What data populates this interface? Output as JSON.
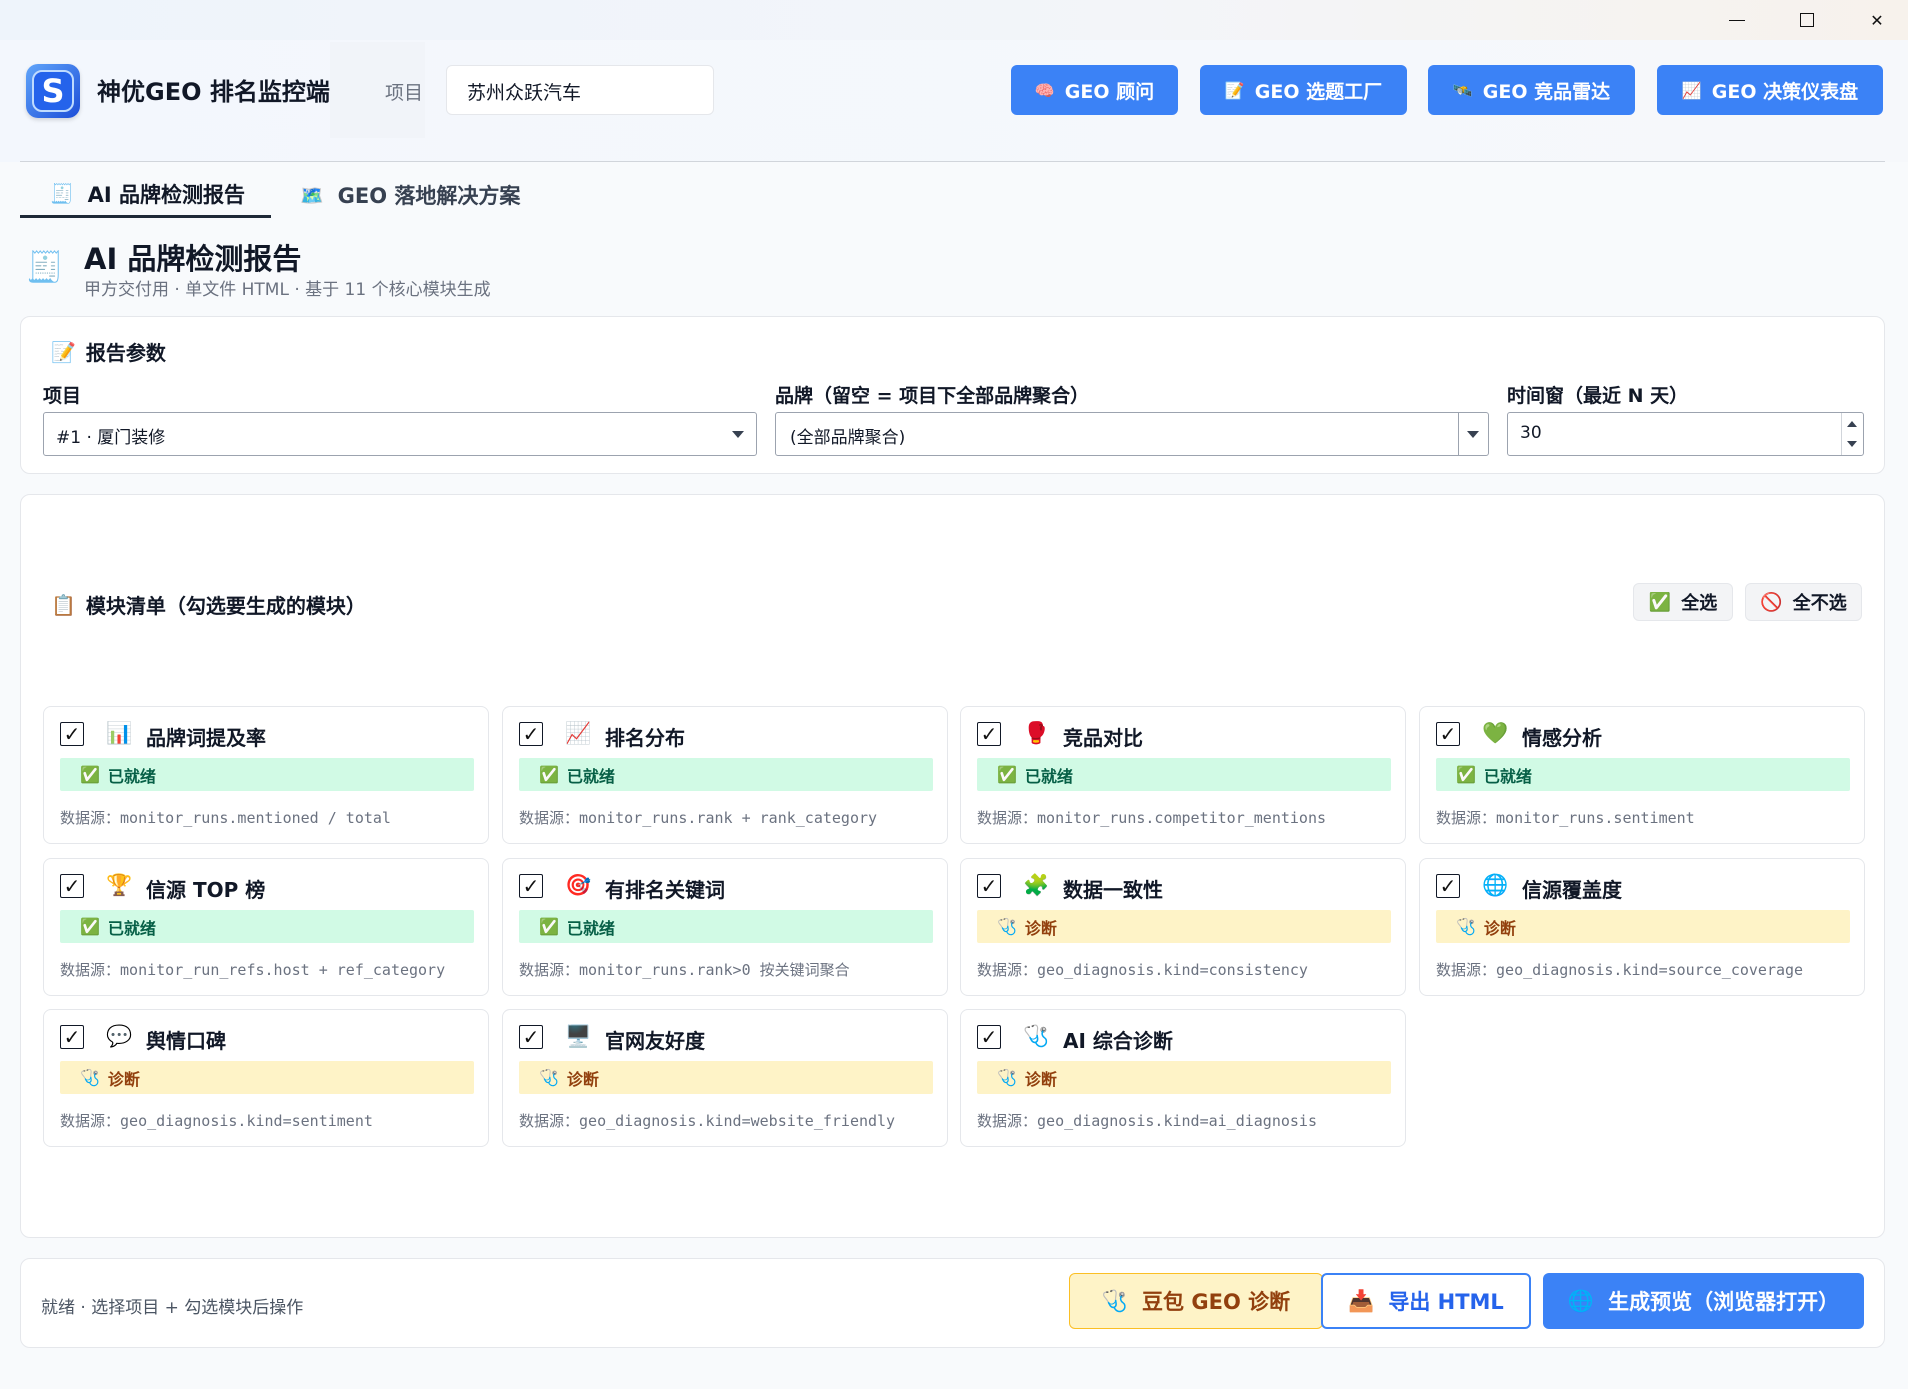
{
  "window": {
    "minimize": "—",
    "maximize": "☐",
    "close": "✕"
  },
  "app": {
    "logo_letter": "S",
    "title": "神优GEO 排名监控端",
    "project_label": "项目",
    "project_value": "苏州众跃汽车"
  },
  "toolbar": [
    {
      "icon": "🧠",
      "label": "GEO 顾问"
    },
    {
      "icon": "📝",
      "label": "GEO 选题工厂"
    },
    {
      "icon": "🛰️",
      "label": "GEO 竞品雷达"
    },
    {
      "icon": "📈",
      "label": "GEO 决策仪表盘"
    }
  ],
  "tabs": [
    {
      "icon": "🧾",
      "label": "AI 品牌检测报告"
    },
    {
      "icon": "🗺️",
      "label": "GEO 落地解决方案"
    }
  ],
  "page": {
    "icon": "🧾",
    "title": "AI 品牌检测报告",
    "subtitle": "甲方交付用 · 单文件 HTML · 基于 11 个核心模块生成"
  },
  "params": {
    "title_icon": "📝",
    "title": "报告参数",
    "project_label": "项目",
    "project_value": "#1 · 厦门装修",
    "brand_label": "品牌（留空 = 项目下全部品牌聚合）",
    "brand_value": "(全部品牌聚合)",
    "window_label": "时间窗（最近 N 天）",
    "window_value": "30"
  },
  "modules": {
    "title_icon": "📋",
    "title": "模块清单（勾选要生成的模块）",
    "select_all": "全选",
    "select_all_icon": "✅",
    "select_none": "全不选",
    "select_none_icon": "🚫",
    "source_prefix": "数据源：",
    "items": [
      {
        "icon": "📊",
        "name": "品牌词提及率",
        "status": "已就绪",
        "status_type": "ready",
        "checked": true,
        "source": "monitor_runs.mentioned / total"
      },
      {
        "icon": "📈",
        "name": "排名分布",
        "status": "已就绪",
        "status_type": "ready",
        "checked": true,
        "source": "monitor_runs.rank + rank_category"
      },
      {
        "icon": "🥊",
        "name": "竞品对比",
        "status": "已就绪",
        "status_type": "ready",
        "checked": true,
        "source": "monitor_runs.competitor_mentions"
      },
      {
        "icon": "💚",
        "name": "情感分析",
        "status": "已就绪",
        "status_type": "ready",
        "checked": true,
        "source": "monitor_runs.sentiment"
      },
      {
        "icon": "🏆",
        "name": "信源 TOP 榜",
        "status": "已就绪",
        "status_type": "ready",
        "checked": true,
        "source": "monitor_run_refs.host + ref_category"
      },
      {
        "icon": "🎯",
        "name": "有排名关键词",
        "status": "已就绪",
        "status_type": "ready",
        "checked": true,
        "source": "monitor_runs.rank>0 按关键词聚合"
      },
      {
        "icon": "🧩",
        "name": "数据一致性",
        "status": "诊断",
        "status_type": "diag",
        "checked": true,
        "source": "geo_diagnosis.kind=consistency"
      },
      {
        "icon": "🌐",
        "name": "信源覆盖度",
        "status": "诊断",
        "status_type": "diag",
        "checked": true,
        "source": "geo_diagnosis.kind=source_coverage"
      },
      {
        "icon": "💬",
        "name": "舆情口碑",
        "status": "诊断",
        "status_type": "diag",
        "checked": true,
        "source": "geo_diagnosis.kind=sentiment"
      },
      {
        "icon": "🖥️",
        "name": "官网友好度",
        "status": "诊断",
        "status_type": "diag",
        "checked": true,
        "source": "geo_diagnosis.kind=website_friendly"
      },
      {
        "icon": "🩺",
        "name": "AI 综合诊断",
        "status": "诊断",
        "status_type": "diag",
        "checked": true,
        "source": "geo_diagnosis.kind=ai_diagnosis"
      }
    ],
    "ready_icon": "✅",
    "diag_icon": "🩺",
    "check_mark": "✓"
  },
  "footer": {
    "status": "就绪 · 选择项目 + 勾选模块后操作",
    "btn_diag_icon": "🩺",
    "btn_diag": "豆包 GEO 诊断",
    "btn_export_icon": "📥",
    "btn_export": "导出 HTML",
    "btn_preview_icon": "🌐",
    "btn_preview": "生成预览（浏览器打开）"
  }
}
